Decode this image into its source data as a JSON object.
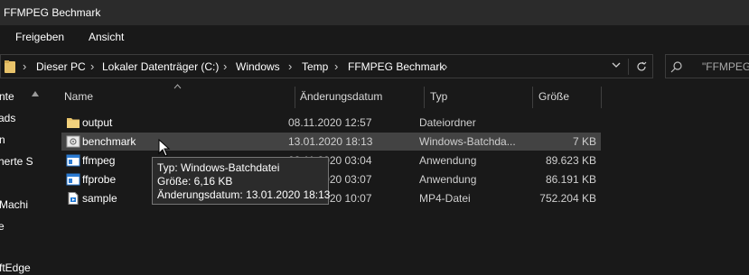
{
  "window": {
    "title": "FFMPEG Bechmark"
  },
  "ribbon": {
    "tabs": [
      "Freigeben",
      "Ansicht"
    ]
  },
  "address": {
    "segments": [
      "Dieser PC",
      "Lokaler Datenträger (C:)",
      "Windows",
      "Temp",
      "FFMPEG Bechmark"
    ]
  },
  "search": {
    "placeholder": "\"FFMPEG"
  },
  "nav": {
    "items": [
      "nte",
      "ads",
      "n",
      "herte S",
      "Machi",
      "e",
      "ftEdge"
    ]
  },
  "columns": {
    "name": "Name",
    "date": "Änderungsdatum",
    "type": "Typ",
    "size": "Größe"
  },
  "files": [
    {
      "name": "output",
      "date": "08.11.2020 12:57",
      "type": "Dateiordner",
      "size": "",
      "icon": "folder-icon"
    },
    {
      "name": "benchmark",
      "date": "13.01.2020 18:13",
      "type": "Windows-Batchda...",
      "size": "7 KB",
      "icon": "batch-file-icon",
      "selected": true
    },
    {
      "name": "ffmpeg",
      "date": "02.11.2020 03:04",
      "type": "Anwendung",
      "size": "89.623 KB",
      "icon": "application-icon"
    },
    {
      "name": "ffprobe",
      "date": "02.11.2020 03:07",
      "type": "Anwendung",
      "size": "86.191 KB",
      "icon": "application-icon"
    },
    {
      "name": "sample",
      "date": "02.11.2020 10:07",
      "type": "MP4-Datei",
      "size": "752.204 KB",
      "icon": "video-file-icon"
    }
  ],
  "tooltip": {
    "type": "Typ: Windows-Batchdatei",
    "size": "Größe: 6,16 KB",
    "date": "Änderungsdatum: 13.01.2020 18:13"
  },
  "colors": {
    "background": "#191919",
    "selection": "#434343",
    "folder": "#e8c36a",
    "app_icon": "#2b7bd3"
  }
}
